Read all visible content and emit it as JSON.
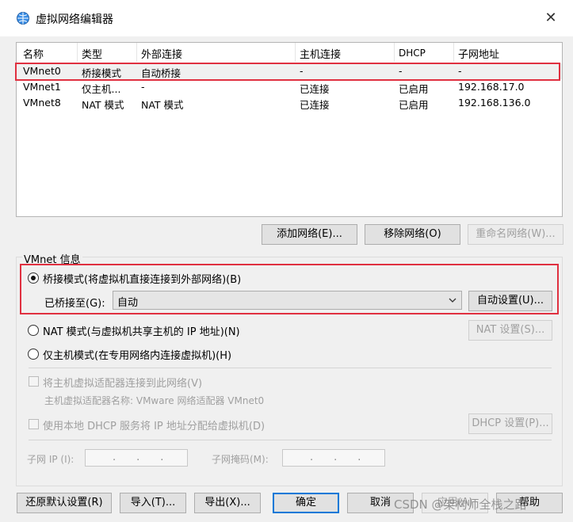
{
  "window": {
    "title": "虚拟网络编辑器",
    "close": "✕"
  },
  "table": {
    "headers": [
      "名称",
      "类型",
      "外部连接",
      "主机连接",
      "DHCP",
      "子网地址"
    ],
    "rows": [
      [
        "VMnet0",
        "桥接模式",
        "自动桥接",
        "-",
        "-",
        "-"
      ],
      [
        "VMnet1",
        "仅主机...",
        "-",
        "已连接",
        "已启用",
        "192.168.17.0"
      ],
      [
        "VMnet8",
        "NAT 模式",
        "NAT 模式",
        "已连接",
        "已启用",
        "192.168.136.0"
      ]
    ]
  },
  "table_buttons": {
    "add": "添加网络(E)...",
    "remove": "移除网络(O)",
    "rename": "重命名网络(W)..."
  },
  "vmnet_info": {
    "label": "VMnet 信息",
    "bridged_radio": "桥接模式(将虚拟机直接连接到外部网络)(B)",
    "bridged_to_label": "已桥接至(G):",
    "bridged_to_value": "自动",
    "auto_settings": "自动设置(U)...",
    "nat_radio": "NAT 模式(与虚拟机共享主机的 IP 地址)(N)",
    "nat_settings": "NAT 设置(S)...",
    "hostonly_radio": "仅主机模式(在专用网络内连接虚拟机)(H)",
    "connect_adapter": "将主机虚拟适配器连接到此网络(V)",
    "adapter_name": "主机虚拟适配器名称: VMware 网络适配器 VMnet0",
    "use_dhcp": "使用本地 DHCP 服务将 IP 地址分配给虚拟机(D)",
    "dhcp_settings": "DHCP 设置(P)...",
    "subnet_ip_label": "子网 IP (I):",
    "subnet_mask_label": "子网掩码(M):",
    "ip_dots": "...",
    "mask_dots": "..."
  },
  "bottom_buttons": {
    "restore": "还原默认设置(R)",
    "import": "导入(T)...",
    "export": "导出(X)...",
    "ok": "确定",
    "cancel": "取消",
    "apply": "应用(A)",
    "help": "帮助"
  },
  "watermark": "CSDN @架构师全栈之路",
  "colors": {
    "highlight_border": "#e03040",
    "primary_border": "#0078d7"
  }
}
